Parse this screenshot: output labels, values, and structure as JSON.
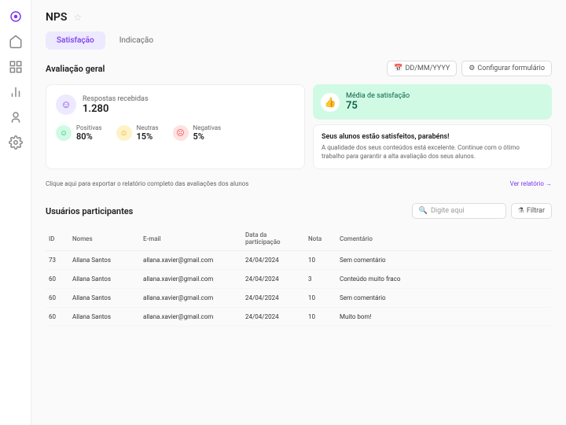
{
  "header": {
    "title": "NPS"
  },
  "tabs": [
    {
      "label": "Satisfação",
      "active": true
    },
    {
      "label": "Indicação",
      "active": false
    }
  ],
  "overview": {
    "title": "Avaliação geral",
    "date_button": "DD/MM/YYYY",
    "config_button": "Configurar formulário",
    "responses": {
      "label": "Respostas recebidas",
      "value": "1.280"
    },
    "positives": {
      "label": "Positivas",
      "value": "80%"
    },
    "neutrals": {
      "label": "Neutras",
      "value": "15%"
    },
    "negatives": {
      "label": "Negativas",
      "value": "5%"
    },
    "satisfaction": {
      "label": "Média de satisfação",
      "value": "75"
    },
    "message": {
      "title": "Seus alunos estão satisfeitos, parabéns!",
      "text": "A qualidade dos seus conteúdos está excelente. Continue com o ótimo trabalho para garantir a alta avaliação dos seus alunos."
    }
  },
  "export": {
    "text": "Clique aqui para exportar o relatório completo das avaliações dos alunos",
    "link": "Ver relatório"
  },
  "participants": {
    "title": "Usuários participantes",
    "search_placeholder": "Digite aqui",
    "filter_button": "Filtrar",
    "columns": {
      "id": "ID",
      "name": "Nomes",
      "email": "E-mail",
      "date": "Data da participação",
      "score": "Nota",
      "comment": "Comentário"
    },
    "rows": [
      {
        "id": "73",
        "name": "Allana Santos",
        "email": "allana.xavier@gmail.com",
        "date": "24/04/2024",
        "score": "10",
        "comment": "Sem comentário"
      },
      {
        "id": "60",
        "name": "Allana Santos",
        "email": "allana.xavier@gmail.com",
        "date": "24/04/2024",
        "score": "3",
        "comment": "Conteúdo muito fraco"
      },
      {
        "id": "60",
        "name": "Allana Santos",
        "email": "allana.xavier@gmail.com",
        "date": "24/04/2024",
        "score": "10",
        "comment": "Sem comentário"
      },
      {
        "id": "60",
        "name": "Allana Santos",
        "email": "allana.xavier@gmail.com",
        "date": "24/04/2024",
        "score": "10",
        "comment": "Muito bom!"
      }
    ]
  }
}
